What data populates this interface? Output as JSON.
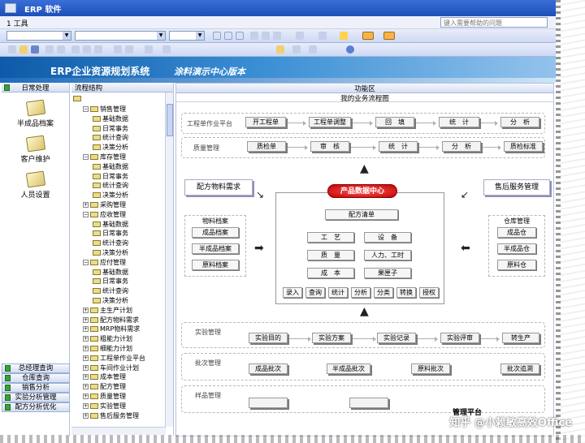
{
  "window": {
    "title": "ERP 软件"
  },
  "menu": {
    "first": "1 工具",
    "help_placeholder": "键入需要帮助的问题"
  },
  "banner": {
    "title": "ERP企业资源规划系统",
    "subtitle": "涂料演示中心版本"
  },
  "left_panel": {
    "header": "日常处理",
    "items": [
      {
        "label": "半成品档案"
      },
      {
        "label": "客户维护"
      },
      {
        "label": "人员设置"
      }
    ],
    "bottom_buttons": [
      "总经理查询",
      "仓库查询",
      "销售分析",
      "实验分析管理",
      "配方分析优化"
    ]
  },
  "tree": {
    "header": "流程结构",
    "nodes": [
      {
        "label": "销售管理",
        "level": 0,
        "expanded": true
      },
      {
        "label": "基础数据",
        "level": 1
      },
      {
        "label": "日常事务",
        "level": 1
      },
      {
        "label": "统计查询",
        "level": 1
      },
      {
        "label": "决策分析",
        "level": 1
      },
      {
        "label": "库存管理",
        "level": 0,
        "expanded": true
      },
      {
        "label": "基础数据",
        "level": 1
      },
      {
        "label": "日常事务",
        "level": 1
      },
      {
        "label": "统计查询",
        "level": 1
      },
      {
        "label": "决策分析",
        "level": 1
      },
      {
        "label": "采购管理",
        "level": 0,
        "expanded": false
      },
      {
        "label": "应收管理",
        "level": 0,
        "expanded": true
      },
      {
        "label": "基础数据",
        "level": 1
      },
      {
        "label": "日常事务",
        "level": 1
      },
      {
        "label": "统计查询",
        "level": 1
      },
      {
        "label": "决策分析",
        "level": 1
      },
      {
        "label": "应付管理",
        "level": 0,
        "expanded": true
      },
      {
        "label": "基础数据",
        "level": 1
      },
      {
        "label": "日常事务",
        "level": 1
      },
      {
        "label": "统计查询",
        "level": 1
      },
      {
        "label": "决策分析",
        "level": 1
      },
      {
        "label": "主生产计划",
        "level": 0
      },
      {
        "label": "配方物料需求",
        "level": 0
      },
      {
        "label": "MRP物料需求",
        "level": 0
      },
      {
        "label": "粗能力计划",
        "level": 0
      },
      {
        "label": "细能力计划",
        "level": 0
      },
      {
        "label": "工程单作业平台",
        "level": 0
      },
      {
        "label": "车间作业计划",
        "level": 0
      },
      {
        "label": "成本管理",
        "level": 0
      },
      {
        "label": "配方管理",
        "level": 0
      },
      {
        "label": "质量管理",
        "level": 0
      },
      {
        "label": "实验管理",
        "level": 0
      },
      {
        "label": "售后服务管理",
        "level": 0
      }
    ]
  },
  "main": {
    "header": "功能区",
    "subheader": "我的业务流程图",
    "rows": [
      {
        "label": "工程单作业平台",
        "steps": [
          "开工程单",
          "工程单调整",
          "回　填",
          "统　计",
          "分　析"
        ]
      },
      {
        "label": "质量管理",
        "steps": [
          "质检单",
          "审　核",
          "统　计",
          "分　析",
          "质检标准"
        ]
      }
    ],
    "left_box": "配方物料需求",
    "right_box": "售后服务管理",
    "material_group": {
      "title": "物料档案",
      "items": [
        "成品档案",
        "半成品档案",
        "原料档案"
      ]
    },
    "warehouse_group": {
      "title": "仓库管理",
      "items": [
        "成品仓",
        "半成品仓",
        "原料仓"
      ]
    },
    "center": {
      "title": "产品数据中心",
      "formula_btn": "配方清单",
      "grid": [
        "工　艺",
        "设　备",
        "质　量",
        "人力、工时",
        "成　本",
        "果匣子"
      ],
      "actions": [
        "录入",
        "查询",
        "统计",
        "分析",
        "分类",
        "转换",
        "授权"
      ]
    },
    "lower_rows": [
      {
        "label": "实验管理",
        "steps": [
          "实验目的",
          "实验方案",
          "实验记录",
          "实验评审",
          "转生产"
        ]
      },
      {
        "label": "批次管理",
        "steps": [
          "成品批次",
          "半成品批次",
          "原料批次",
          "批次追溯"
        ]
      },
      {
        "label": "样品管理",
        "steps": []
      }
    ],
    "footer_label": "管理平台"
  },
  "watermark": "知乎 @小赖敏高效Office"
}
